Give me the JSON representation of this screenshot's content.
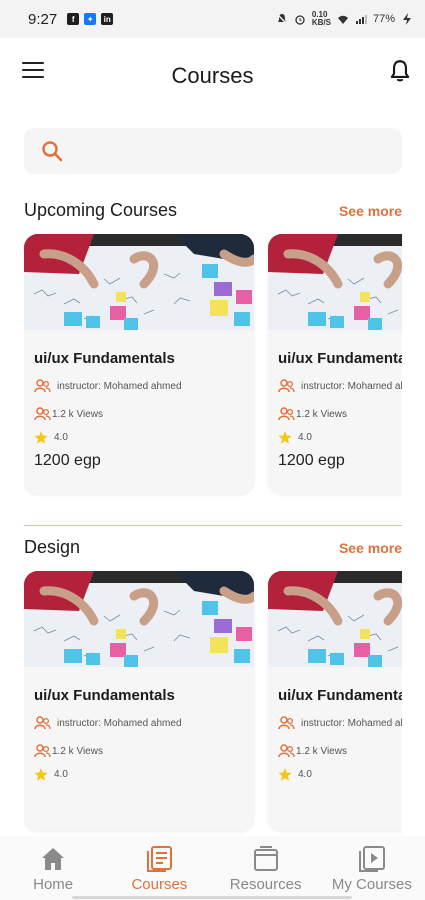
{
  "status_bar": {
    "time": "9:27",
    "network": "0.10\nKB/S",
    "battery": "77%"
  },
  "header": {
    "title": "Courses"
  },
  "search": {
    "placeholder": ""
  },
  "colors": {
    "accent": "#e2703a",
    "card_bg": "#f6f6f6",
    "inactive": "#8a8a8a"
  },
  "sections": [
    {
      "title": "Upcoming Courses",
      "see_more": "See more",
      "cards": [
        {
          "title": "ui/ux Fundamentals",
          "instructor": "instructor: Mohamed ahmed",
          "views": "1.2 k Views",
          "rating": "4.0",
          "price": "1200 egp"
        },
        {
          "title": "ui/ux Fundamentals",
          "instructor": "instructor: Mohamed ahmed",
          "views": "1.2 k Views",
          "rating": "4.0",
          "price": "1200 egp"
        }
      ]
    },
    {
      "title": "Design",
      "see_more": "See more",
      "cards": [
        {
          "title": "ui/ux Fundamentals",
          "instructor": "instructor: Mohamed ahmed",
          "views": "1.2 k Views",
          "rating": "4.0"
        },
        {
          "title": "ui/ux Fundamentals",
          "instructor": "instructor: Mohamed ahmed",
          "views": "1.2 k Views",
          "rating": "4.0"
        }
      ]
    }
  ],
  "bottom_nav": [
    {
      "label": "Home",
      "icon": "home-icon",
      "active": false
    },
    {
      "label": "Courses",
      "icon": "courses-icon",
      "active": true
    },
    {
      "label": "Resources",
      "icon": "resources-icon",
      "active": false
    },
    {
      "label": "My Courses",
      "icon": "play-icon",
      "active": false
    }
  ]
}
